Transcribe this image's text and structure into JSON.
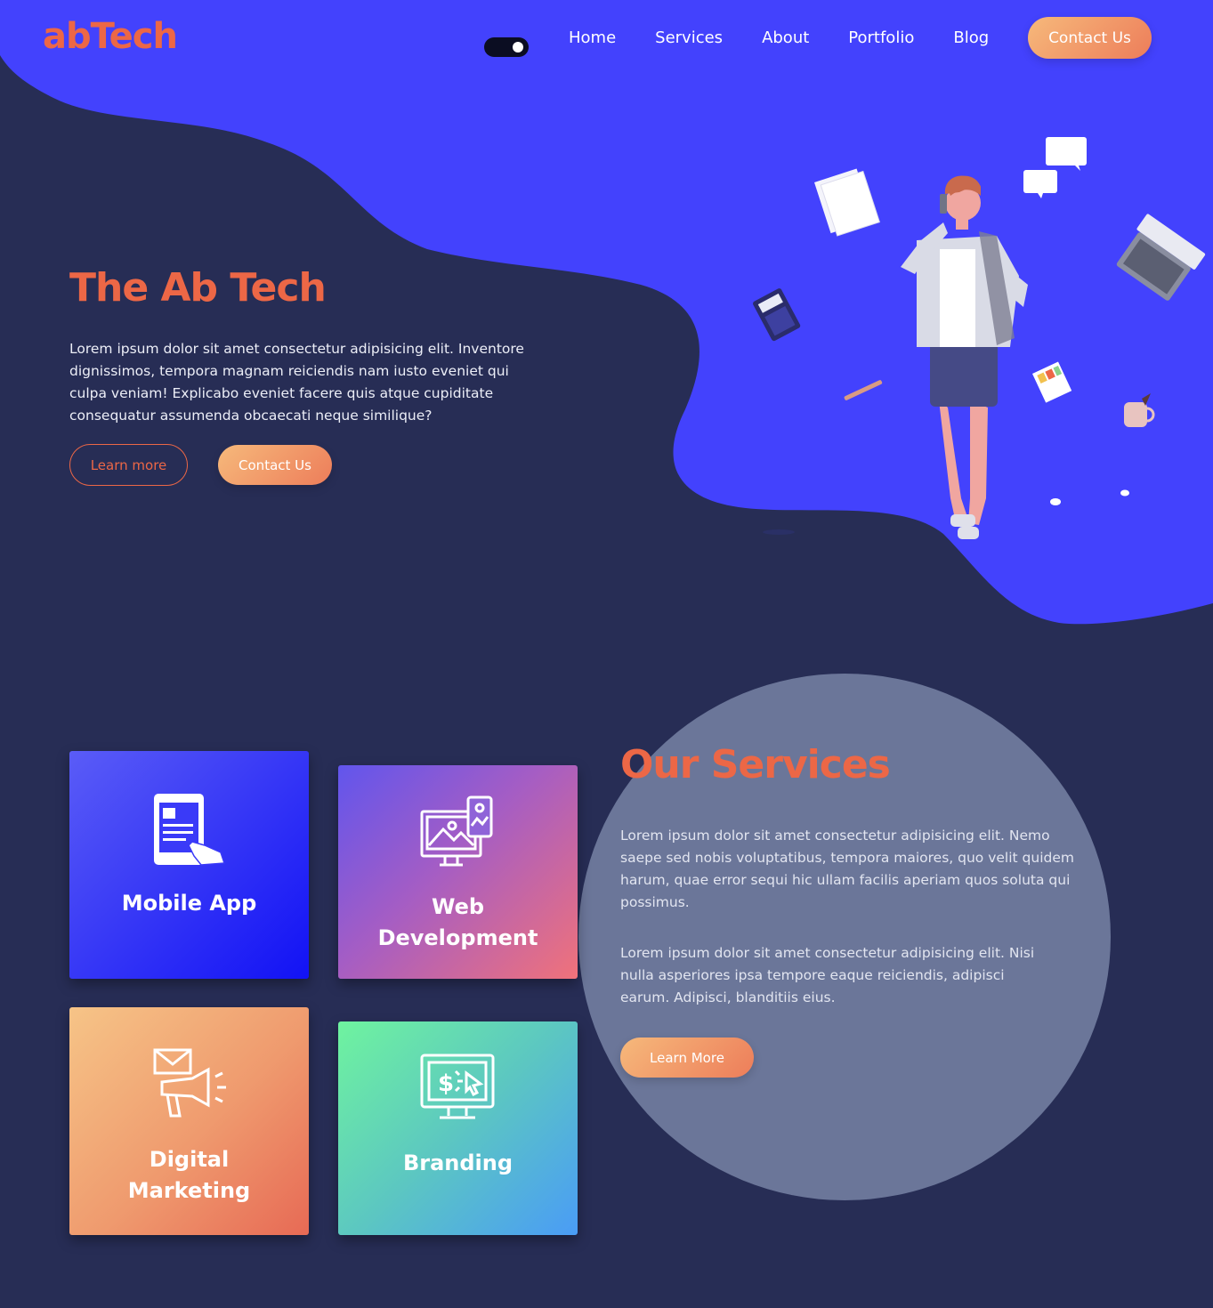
{
  "brand": {
    "logo_prefix": "ab",
    "logo_suffix": "Tech"
  },
  "colors": {
    "background": "#272d55",
    "blob": "#4342fd",
    "accent": "#ec6746",
    "circle": "#6b7699"
  },
  "theme_toggle": {
    "state": "on"
  },
  "nav": {
    "items": [
      {
        "label": "Home"
      },
      {
        "label": "Services"
      },
      {
        "label": "About"
      },
      {
        "label": "Portfolio"
      },
      {
        "label": "Blog"
      }
    ],
    "contact_label": "Contact Us"
  },
  "hero": {
    "title": "The Ab Tech",
    "text": "Lorem ipsum dolor sit amet consectetur adipisicing elit. Inventore dignissimos, tempora magnam reiciendis nam iusto eveniet qui culpa veniam! Explicabo eveniet facere quis atque cupiditate consequatur assumenda obcaecati neque similique?",
    "learn_more_label": "Learn more",
    "contact_label": "Contact Us"
  },
  "services": {
    "title": "Our Services",
    "paragraph_1": "Lorem ipsum dolor sit amet consectetur adipisicing elit. Nemo saepe sed nobis voluptatibus, tempora maiores, quo velit quidem harum, quae error sequi hic ullam facilis aperiam quos soluta qui possimus.",
    "paragraph_2": "Lorem ipsum dolor sit amet consectetur adipisicing elit. Nisi nulla asperiores ipsa tempore eaque reiciendis, adipisci earum. Adipisci, blanditiis eius.",
    "learn_more_label": "Learn More",
    "cards": [
      {
        "label": "Mobile App",
        "icon": "mobile-app-icon"
      },
      {
        "label": "Web Development",
        "icon": "web-development-icon"
      },
      {
        "label": "Digital Marketing",
        "icon": "megaphone-icon"
      },
      {
        "label": "Branding",
        "icon": "monitor-dollar-icon"
      }
    ]
  }
}
